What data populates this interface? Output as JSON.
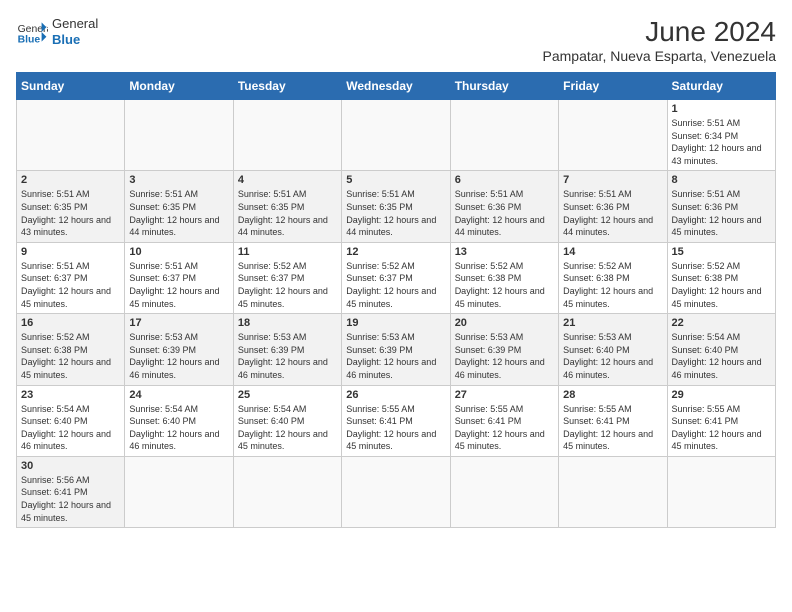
{
  "header": {
    "logo_general": "General",
    "logo_blue": "Blue",
    "month_title": "June 2024",
    "location": "Pampatar, Nueva Esparta, Venezuela"
  },
  "weekdays": [
    "Sunday",
    "Monday",
    "Tuesday",
    "Wednesday",
    "Thursday",
    "Friday",
    "Saturday"
  ],
  "weeks": [
    [
      {
        "day": "",
        "info": ""
      },
      {
        "day": "",
        "info": ""
      },
      {
        "day": "",
        "info": ""
      },
      {
        "day": "",
        "info": ""
      },
      {
        "day": "",
        "info": ""
      },
      {
        "day": "",
        "info": ""
      },
      {
        "day": "1",
        "info": "Sunrise: 5:51 AM\nSunset: 6:34 PM\nDaylight: 12 hours and 43 minutes."
      }
    ],
    [
      {
        "day": "2",
        "info": "Sunrise: 5:51 AM\nSunset: 6:35 PM\nDaylight: 12 hours and 43 minutes."
      },
      {
        "day": "3",
        "info": "Sunrise: 5:51 AM\nSunset: 6:35 PM\nDaylight: 12 hours and 44 minutes."
      },
      {
        "day": "4",
        "info": "Sunrise: 5:51 AM\nSunset: 6:35 PM\nDaylight: 12 hours and 44 minutes."
      },
      {
        "day": "5",
        "info": "Sunrise: 5:51 AM\nSunset: 6:35 PM\nDaylight: 12 hours and 44 minutes."
      },
      {
        "day": "6",
        "info": "Sunrise: 5:51 AM\nSunset: 6:36 PM\nDaylight: 12 hours and 44 minutes."
      },
      {
        "day": "7",
        "info": "Sunrise: 5:51 AM\nSunset: 6:36 PM\nDaylight: 12 hours and 44 minutes."
      },
      {
        "day": "8",
        "info": "Sunrise: 5:51 AM\nSunset: 6:36 PM\nDaylight: 12 hours and 45 minutes."
      }
    ],
    [
      {
        "day": "9",
        "info": "Sunrise: 5:51 AM\nSunset: 6:37 PM\nDaylight: 12 hours and 45 minutes."
      },
      {
        "day": "10",
        "info": "Sunrise: 5:51 AM\nSunset: 6:37 PM\nDaylight: 12 hours and 45 minutes."
      },
      {
        "day": "11",
        "info": "Sunrise: 5:52 AM\nSunset: 6:37 PM\nDaylight: 12 hours and 45 minutes."
      },
      {
        "day": "12",
        "info": "Sunrise: 5:52 AM\nSunset: 6:37 PM\nDaylight: 12 hours and 45 minutes."
      },
      {
        "day": "13",
        "info": "Sunrise: 5:52 AM\nSunset: 6:38 PM\nDaylight: 12 hours and 45 minutes."
      },
      {
        "day": "14",
        "info": "Sunrise: 5:52 AM\nSunset: 6:38 PM\nDaylight: 12 hours and 45 minutes."
      },
      {
        "day": "15",
        "info": "Sunrise: 5:52 AM\nSunset: 6:38 PM\nDaylight: 12 hours and 45 minutes."
      }
    ],
    [
      {
        "day": "16",
        "info": "Sunrise: 5:52 AM\nSunset: 6:38 PM\nDaylight: 12 hours and 45 minutes."
      },
      {
        "day": "17",
        "info": "Sunrise: 5:53 AM\nSunset: 6:39 PM\nDaylight: 12 hours and 46 minutes."
      },
      {
        "day": "18",
        "info": "Sunrise: 5:53 AM\nSunset: 6:39 PM\nDaylight: 12 hours and 46 minutes."
      },
      {
        "day": "19",
        "info": "Sunrise: 5:53 AM\nSunset: 6:39 PM\nDaylight: 12 hours and 46 minutes."
      },
      {
        "day": "20",
        "info": "Sunrise: 5:53 AM\nSunset: 6:39 PM\nDaylight: 12 hours and 46 minutes."
      },
      {
        "day": "21",
        "info": "Sunrise: 5:53 AM\nSunset: 6:40 PM\nDaylight: 12 hours and 46 minutes."
      },
      {
        "day": "22",
        "info": "Sunrise: 5:54 AM\nSunset: 6:40 PM\nDaylight: 12 hours and 46 minutes."
      }
    ],
    [
      {
        "day": "23",
        "info": "Sunrise: 5:54 AM\nSunset: 6:40 PM\nDaylight: 12 hours and 46 minutes."
      },
      {
        "day": "24",
        "info": "Sunrise: 5:54 AM\nSunset: 6:40 PM\nDaylight: 12 hours and 46 minutes."
      },
      {
        "day": "25",
        "info": "Sunrise: 5:54 AM\nSunset: 6:40 PM\nDaylight: 12 hours and 45 minutes."
      },
      {
        "day": "26",
        "info": "Sunrise: 5:55 AM\nSunset: 6:41 PM\nDaylight: 12 hours and 45 minutes."
      },
      {
        "day": "27",
        "info": "Sunrise: 5:55 AM\nSunset: 6:41 PM\nDaylight: 12 hours and 45 minutes."
      },
      {
        "day": "28",
        "info": "Sunrise: 5:55 AM\nSunset: 6:41 PM\nDaylight: 12 hours and 45 minutes."
      },
      {
        "day": "29",
        "info": "Sunrise: 5:55 AM\nSunset: 6:41 PM\nDaylight: 12 hours and 45 minutes."
      }
    ],
    [
      {
        "day": "30",
        "info": "Sunrise: 5:56 AM\nSunset: 6:41 PM\nDaylight: 12 hours and 45 minutes."
      },
      {
        "day": "",
        "info": ""
      },
      {
        "day": "",
        "info": ""
      },
      {
        "day": "",
        "info": ""
      },
      {
        "day": "",
        "info": ""
      },
      {
        "day": "",
        "info": ""
      },
      {
        "day": "",
        "info": ""
      }
    ]
  ]
}
